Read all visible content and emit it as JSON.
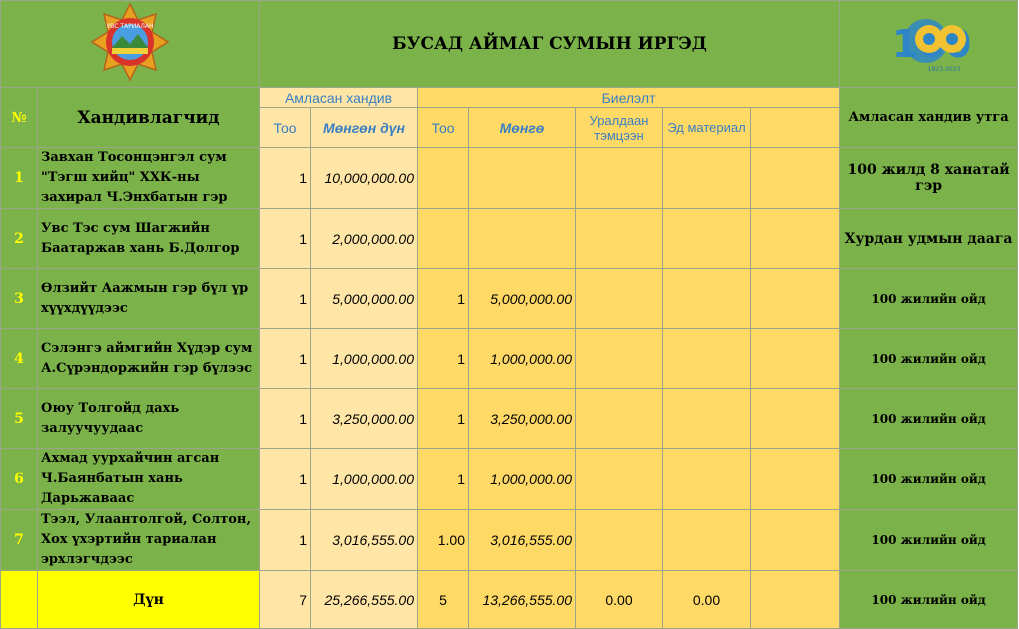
{
  "title": "БУСАД АЙМАГ СУМЫН  ИРГЭД",
  "logos": {
    "left_badge_text": "УВС ТАРИАЛАН",
    "right_emblem_number": "100",
    "right_emblem_years": "1923-2023"
  },
  "headers": {
    "num": "№",
    "donors": "Хандивлагчид",
    "pledged_group": "Амласан хандив",
    "fulfilled_group": "Биелэлт",
    "meaning": "Амласан хандив утга",
    "pledged_count": "Тоо",
    "pledged_amount": "Мөнгөн дүн",
    "fulfilled_count": "Тоо",
    "fulfilled_money": "Мөнгө",
    "prize": "Уралдаан тэмцээн",
    "material": "Эд материал"
  },
  "rows": [
    {
      "num": "1",
      "donor": "Завхан Тосонцэнгэл сум \"Тэгш хийц\" ХХК-ны захирал Ч.Энхбатын гэр",
      "pledged_count": "1",
      "pledged_amount": "10,000,000.00",
      "fulfilled_count": "",
      "fulfilled_money": "",
      "prize": "",
      "material": "",
      "meaning": "100 жилд 8 ханатай гэр"
    },
    {
      "num": "2",
      "donor": "Увс Тэс сум Шагжийн Баатаржав хань Б.Долгор",
      "pledged_count": "1",
      "pledged_amount": "2,000,000.00",
      "fulfilled_count": "",
      "fulfilled_money": "",
      "prize": "",
      "material": "",
      "meaning": "Хурдан удмын даага"
    },
    {
      "num": "3",
      "donor": "Өлзийт Аажмын гэр бүл үр хүүхдүүдээс",
      "pledged_count": "1",
      "pledged_amount": "5,000,000.00",
      "fulfilled_count": "1",
      "fulfilled_money": "5,000,000.00",
      "prize": "",
      "material": "",
      "meaning": "100 жилийн ойд"
    },
    {
      "num": "4",
      "donor": "Сэлэнгэ аймгийн Хүдэр сум А.Сүрэндоржийн гэр бүлээс",
      "pledged_count": "1",
      "pledged_amount": "1,000,000.00",
      "fulfilled_count": "1",
      "fulfilled_money": "1,000,000.00",
      "prize": "",
      "material": "",
      "meaning": "100 жилийн ойд"
    },
    {
      "num": "5",
      "donor": "Оюу Толгойд дахь залуучуудаас",
      "pledged_count": "1",
      "pledged_amount": "3,250,000.00",
      "fulfilled_count": "1",
      "fulfilled_money": "3,250,000.00",
      "prize": "",
      "material": "",
      "meaning": "100 жилийн ойд"
    },
    {
      "num": "6",
      "donor": "Ахмад уурхайчин агсан Ч.Баянбатын  хань Дарьжаваас",
      "pledged_count": "1",
      "pledged_amount": "1,000,000.00",
      "fulfilled_count": "1",
      "fulfilled_money": "1,000,000.00",
      "prize": "",
      "material": "",
      "meaning": "100 жилийн ойд"
    },
    {
      "num": "7",
      "donor": "Тээл, Улаантолгой, Солтон, Хох үхэртийн тариалан эрхлэгчдээс",
      "pledged_count": "1",
      "pledged_amount": "3,016,555.00",
      "fulfilled_count": "1.00",
      "fulfilled_money": "3,016,555.00",
      "prize": "",
      "material": "",
      "meaning": "100 жилийн ойд"
    }
  ],
  "total": {
    "label": "Дүн",
    "pledged_count": "7",
    "pledged_amount": "25,266,555.00",
    "fulfilled_count": "5",
    "fulfilled_money": "13,266,555.00",
    "prize": "0.00",
    "material": "0.00",
    "meaning": "100 жилийн ойд"
  }
}
